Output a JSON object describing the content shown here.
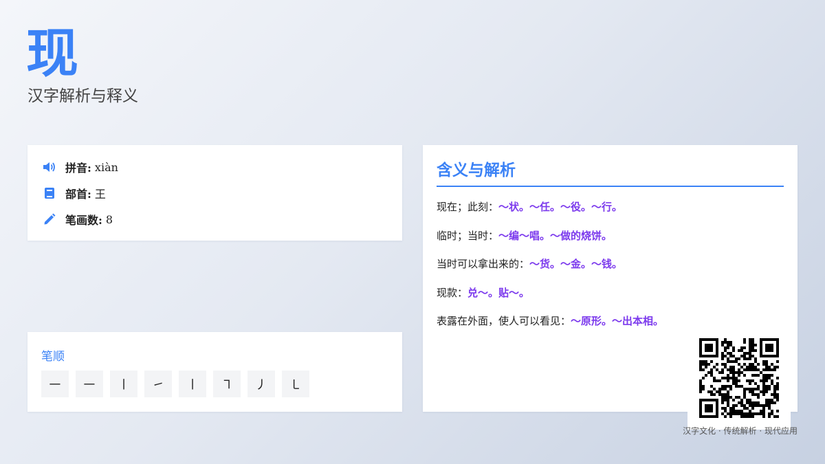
{
  "hero": {
    "character": "现",
    "subtitle": "汉字解析与释义"
  },
  "info": {
    "pinyin_label": "拼音:",
    "pinyin_value": "xiàn",
    "radical_label": "部首:",
    "radical_value": "王",
    "strokes_label": "笔画数:",
    "strokes_value": "8"
  },
  "stroke_order": {
    "title": "笔顺",
    "strokes": [
      "㇐",
      "㇐",
      "㇑",
      "㇀",
      "㇑",
      "㇕",
      "㇓",
      "㇄"
    ]
  },
  "meaning": {
    "title": "含义与解析",
    "lines": [
      {
        "text": "现在；此刻：",
        "examples": "～状。～任。～役。～行。"
      },
      {
        "text": "临时；当时：",
        "examples": "～编～唱。～做的烧饼。"
      },
      {
        "text": "当时可以拿出来的：",
        "examples": "～货。～金。～钱。"
      },
      {
        "text": "现款：",
        "examples": "兑～。贴～。"
      },
      {
        "text": "表露在外面，使人可以看见：",
        "examples": "～原形。～出本相。"
      }
    ]
  },
  "footer": {
    "text": "汉字文化 · 传统解析 · 现代应用"
  },
  "colors": {
    "accent": "#3b82f6",
    "example": "#7c3aed"
  },
  "icons": [
    "speaker-icon",
    "book-icon",
    "pencil-icon"
  ]
}
